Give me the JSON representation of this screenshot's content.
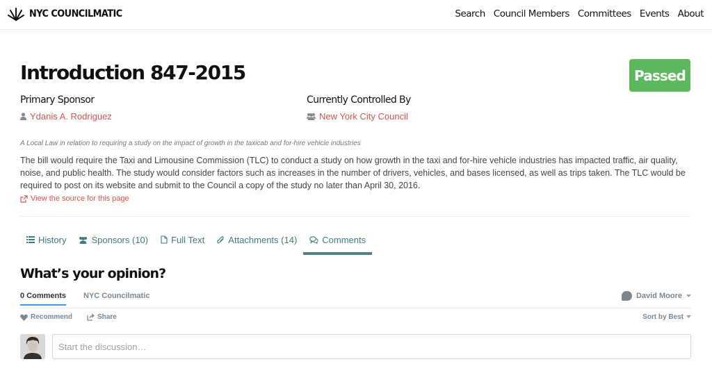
{
  "brand": {
    "name": "NYC COUNCILMATIC"
  },
  "nav": {
    "items": [
      {
        "label": "Search"
      },
      {
        "label": "Council Members"
      },
      {
        "label": "Committees"
      },
      {
        "label": "Events"
      },
      {
        "label": "About"
      }
    ]
  },
  "bill": {
    "title": "Introduction 847-2015",
    "status": "Passed",
    "primary_sponsor_label": "Primary Sponsor",
    "primary_sponsor": "Ydanis A. Rodriguez",
    "controlled_by_label": "Currently Controlled By",
    "controlled_by": "New York City Council",
    "summary": "A Local Law in relation to requiring a study on the impact of growth in the taxicab and for-hire vehicle industries",
    "description": "The bill would require the Taxi and Limousine Commission (TLC) to conduct a study on how growth in the taxi and for-hire vehicle industries has impacted traffic, air quality, noise, and public health. The study would consider factors such as increases in the number of drivers, vehicles, and bases licensed, as well as trips taken. The TLC would be required to post on its website and submit to the Council a copy of the study no later than April 30, 2016.",
    "source_link": "View the source for this page"
  },
  "tabs": [
    {
      "label": "History",
      "icon": "list-icon"
    },
    {
      "label": "Sponsors (10)",
      "icon": "users-icon"
    },
    {
      "label": "Full Text",
      "icon": "file-icon"
    },
    {
      "label": "Attachments (14)",
      "icon": "paperclip-icon"
    },
    {
      "label": "Comments",
      "icon": "comments-icon",
      "active": true
    }
  ],
  "comments": {
    "heading": "What’s your opinion?",
    "count_tab": "0 Comments",
    "site_tab": "NYC Councilmatic",
    "user": "David Moore",
    "recommend": "Recommend",
    "share": "Share",
    "sort": "Sort by Best",
    "placeholder": "Start the discussion…"
  },
  "colors": {
    "link": "#d9534f",
    "tab": "#3f7a80",
    "status_passed": "#5cb85c",
    "disqus_blue": "#2e9fff"
  }
}
